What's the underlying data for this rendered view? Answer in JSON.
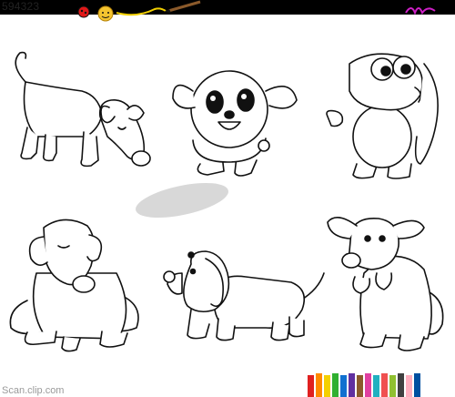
{
  "image": {
    "id_label": "594323",
    "footer_label": "Scan.clip.com",
    "decor": {
      "top_icons": [
        "ladybug-icon",
        "sun-icon",
        "paintbrush-icon"
      ],
      "bottom_icons": [
        "colored-pencils"
      ]
    },
    "colors": {
      "top_stripe": "#000000",
      "outline": "#111111",
      "shadow": "#d8d8d8",
      "watermark_mark": "#d020c8"
    },
    "watermark_mark": "m"
  }
}
